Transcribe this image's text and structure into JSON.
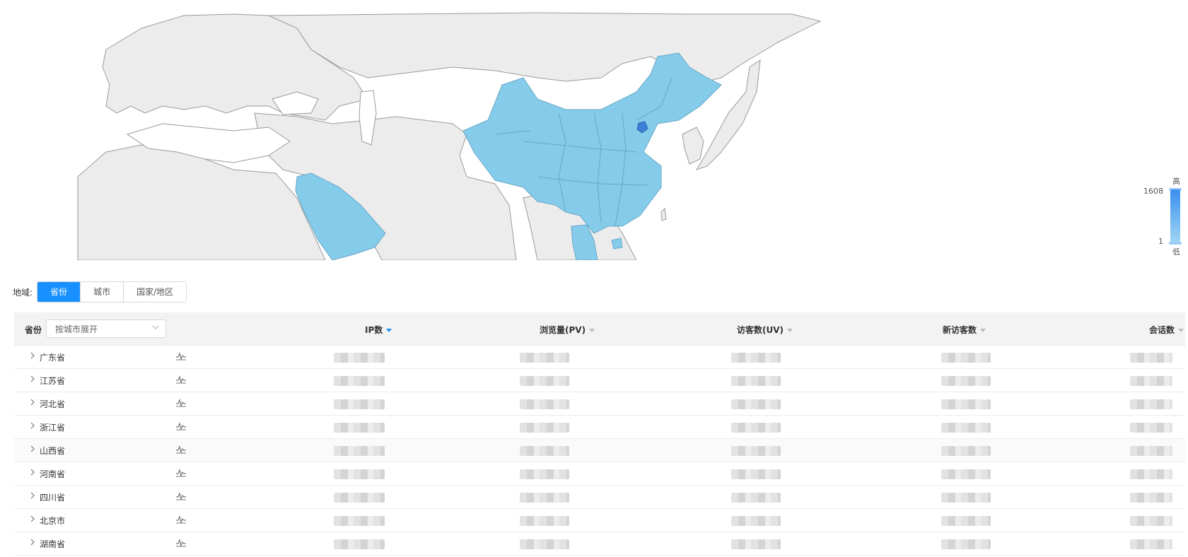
{
  "legend": {
    "high_label": "高",
    "low_label": "低",
    "max": "1608",
    "min": "1"
  },
  "filters": {
    "label": "地域:",
    "tabs": [
      {
        "label": "省份",
        "active": true
      },
      {
        "label": "城市",
        "active": false
      },
      {
        "label": "国家/地区",
        "active": false
      }
    ]
  },
  "table": {
    "header_label": "省份",
    "group_select": "按城市展开",
    "columns": [
      {
        "label": "IP数",
        "sorted": true
      },
      {
        "label": "浏览量(PV)",
        "sorted": false
      },
      {
        "label": "访客数(UV)",
        "sorted": false
      },
      {
        "label": "新访客数",
        "sorted": false
      },
      {
        "label": "会话数",
        "sorted": false
      }
    ],
    "rows": [
      {
        "name": "广东省"
      },
      {
        "name": "江苏省"
      },
      {
        "name": "河北省"
      },
      {
        "name": "浙江省"
      },
      {
        "name": "山西省"
      },
      {
        "name": "河南省"
      },
      {
        "name": "四川省"
      },
      {
        "name": "北京市"
      },
      {
        "name": "湖南省"
      }
    ]
  },
  "colors": {
    "accent": "#1890ff",
    "map_land": "#ececec",
    "map_highlight": "#85cbea",
    "map_peak": "#3b7fd6"
  }
}
